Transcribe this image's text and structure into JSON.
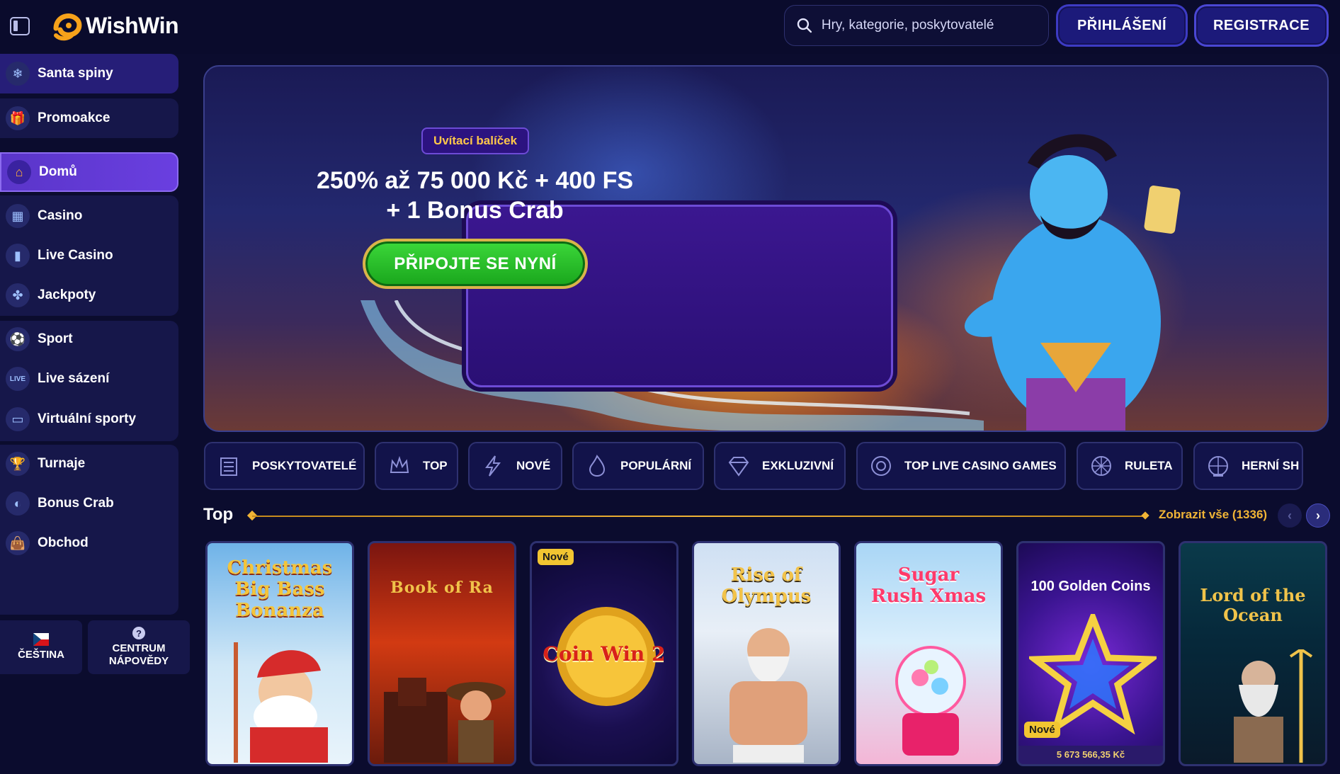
{
  "header": {
    "logo_text": "WishWin",
    "search_placeholder": "Hry, kategorie, poskytovatelé",
    "login_label": "PŘIHLÁŠENÍ",
    "register_label": "REGISTRACE"
  },
  "sidebar": {
    "items": [
      {
        "label": "Santa spiny",
        "icon": "snowflake-icon"
      },
      {
        "label": "Promoakce",
        "icon": "gift-icon"
      },
      {
        "label": "Domů",
        "icon": "home-icon"
      },
      {
        "label": "Casino",
        "icon": "slot-machine-icon"
      },
      {
        "label": "Live Casino",
        "icon": "card-icon"
      },
      {
        "label": "Jackpoty",
        "icon": "clover-icon"
      },
      {
        "label": "Sport",
        "icon": "ball-icon"
      },
      {
        "label": "Live sázení",
        "icon": "live-icon"
      },
      {
        "label": "Virtuální sporty",
        "icon": "monitor-icon"
      },
      {
        "label": "Turnaje",
        "icon": "trophy-icon"
      },
      {
        "label": "Bonus Crab",
        "icon": "crab-icon"
      },
      {
        "label": "Obchod",
        "icon": "shopping-bag-icon"
      }
    ],
    "language_label": "ČEŠTINA",
    "help_label_1": "CENTRUM",
    "help_label_2": "NÁPOVĚDY"
  },
  "banner": {
    "tag": "Uvítací balíček",
    "line1": "250% až 75 000 Kč + 400 FS",
    "line2": "+ 1 Bonus Crab",
    "cta": "PŘIPOJTE SE NYNÍ"
  },
  "categories": [
    {
      "label": "POSKYTOVATELÉ",
      "icon": "providers-icon"
    },
    {
      "label": "TOP",
      "icon": "crown-icon"
    },
    {
      "label": "NOVÉ",
      "icon": "lightning-icon"
    },
    {
      "label": "POPULÁRNÍ",
      "icon": "flame-icon"
    },
    {
      "label": "EXKLUZIVNÍ",
      "icon": "diamond-icon"
    },
    {
      "label": "TOP LIVE CASINO GAMES",
      "icon": "chip-icon"
    },
    {
      "label": "RULETA",
      "icon": "roulette-icon"
    },
    {
      "label": "HERNÍ SH",
      "icon": "wheel-icon"
    }
  ],
  "section": {
    "title": "Top",
    "view_all": "Zobrazit vše (1336)",
    "prev": "‹",
    "next": "›"
  },
  "games": [
    {
      "title": "Christmas Big Bass Bonanza",
      "badge": "",
      "jackpot": ""
    },
    {
      "title": "Book of Ra",
      "badge": "",
      "jackpot": ""
    },
    {
      "title": "Coin Win 2",
      "badge": "Nové",
      "jackpot": ""
    },
    {
      "title": "Rise of Olympus",
      "badge": "",
      "jackpot": ""
    },
    {
      "title": "Sugar Rush Xmas",
      "badge": "",
      "jackpot": ""
    },
    {
      "title": "100 Golden Coins",
      "badge": "Nové",
      "jackpot": "5 673 566,35 Kč"
    },
    {
      "title": "Lord of the Ocean",
      "badge": "",
      "jackpot": ""
    }
  ]
}
